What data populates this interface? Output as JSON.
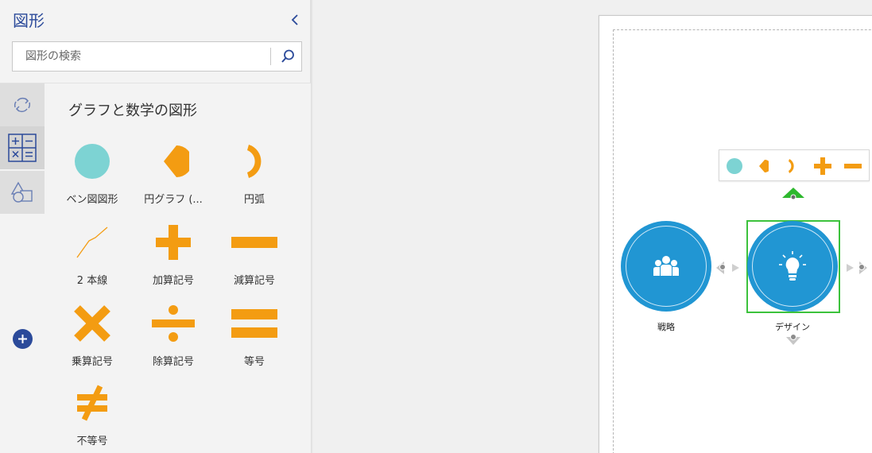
{
  "panel": {
    "title": "図形",
    "search_placeholder": "図形の検索",
    "gallery_title": "グラフと数学の図形"
  },
  "shapes": [
    {
      "name": "venn-shape",
      "label": "ベン図図形"
    },
    {
      "name": "pie-shape",
      "label": "円グラフ (..."
    },
    {
      "name": "arc-shape",
      "label": "円弧"
    },
    {
      "name": "two-lines-shape",
      "label": "2 本線"
    },
    {
      "name": "plus-shape",
      "label": "加算記号"
    },
    {
      "name": "minus-shape",
      "label": "減算記号"
    },
    {
      "name": "multiply-shape",
      "label": "乗算記号"
    },
    {
      "name": "divide-shape",
      "label": "除算記号"
    },
    {
      "name": "equal-shape",
      "label": "等号"
    },
    {
      "name": "not-equal-shape",
      "label": "不等号"
    }
  ],
  "canvas": {
    "nodes": [
      {
        "label": "戦略",
        "icon": "people-icon"
      },
      {
        "label": "デザイン",
        "icon": "lightbulb-icon"
      }
    ]
  },
  "colors": {
    "accent": "#2b4a9a",
    "shape_teal": "#7dd3d3",
    "shape_orange": "#f39c12",
    "node_blue": "#2196d3",
    "selection_green": "#3cc23c"
  }
}
